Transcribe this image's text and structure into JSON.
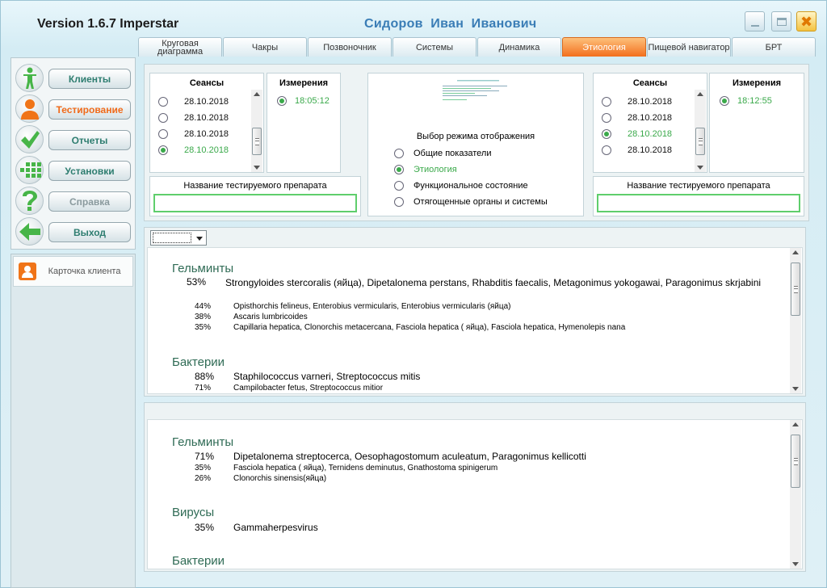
{
  "app": {
    "title": "Version 1.6.7 Imperstar",
    "patient": "Сидоров  Иван  Иванович"
  },
  "window_buttons": {
    "close_glyph": "✖"
  },
  "tabs": [
    "Круговая диаграмма",
    "Чакры",
    "Позвоночник",
    "Системы",
    "Динамика",
    "Этиология",
    "Пищевой навигатор",
    "БРТ"
  ],
  "active_tab": "Этиология",
  "nav": [
    {
      "label": "Клиенты",
      "icon": "person-icon",
      "state": "normal"
    },
    {
      "label": "Тестирование",
      "icon": "user-orange-icon",
      "state": "active"
    },
    {
      "label": "Отчеты",
      "icon": "check-icon",
      "state": "normal"
    },
    {
      "label": "Установки",
      "icon": "grid-icon",
      "state": "normal"
    },
    {
      "label": "Справка",
      "icon": "help-icon",
      "state": "disabled"
    },
    {
      "label": "Выход",
      "icon": "exit-arrow-icon",
      "state": "normal"
    }
  ],
  "card": {
    "label": "Карточка клиента",
    "icon": "client-card-icon"
  },
  "left_sessions": {
    "title": "Сеансы",
    "items": [
      {
        "date": "28.10.2018",
        "selected": false
      },
      {
        "date": "28.10.2018",
        "selected": false
      },
      {
        "date": "28.10.2018",
        "selected": false
      },
      {
        "date": "28.10.2018",
        "selected": true
      }
    ]
  },
  "left_measurements": {
    "title": "Измерения",
    "items": [
      {
        "time": "18:05:12",
        "selected": true
      }
    ]
  },
  "right_sessions": {
    "title": "Сеансы",
    "items": [
      {
        "date": "28.10.2018",
        "selected": false
      },
      {
        "date": "28.10.2018",
        "selected": false
      },
      {
        "date": "28.10.2018",
        "selected": true
      },
      {
        "date": "28.10.2018",
        "selected": false
      }
    ]
  },
  "right_measurements": {
    "title": "Измерения",
    "items": [
      {
        "time": "18:12:55",
        "selected": true
      }
    ]
  },
  "drug": {
    "label": "Название тестируемого препарата",
    "left_value": "",
    "right_value": ""
  },
  "display_mode": {
    "title": "Выбор режима отображения",
    "options": [
      {
        "label": "Общие показатели",
        "selected": false
      },
      {
        "label": "Этиология",
        "selected": true
      },
      {
        "label": "Функциональное состояние",
        "selected": false
      },
      {
        "label": "Отягощенные органы и системы",
        "selected": false
      }
    ]
  },
  "results1": {
    "categories": [
      {
        "name": "Гельминты",
        "entries": [
          {
            "pct": "53%",
            "text": "Strongyloides stercoralis (яйца), Dipetalonema perstans, Rhabditis faecalis, Metagonimus yokogawai, Paragonimus skrjabini",
            "size": "big"
          },
          {
            "pct": "44%",
            "text": "Opisthorchis felineus, Enterobius vermicularis, Enterobius vermicularis (яйца)",
            "size": "small"
          },
          {
            "pct": "38%",
            "text": "Ascaris lumbricoides",
            "size": "small"
          },
          {
            "pct": "35%",
            "text": "Capillaria hepatica, Clonorchis metacercana, Fasciola hepatica ( яйца), Fasciola hepatica, Hymenolepis nana",
            "size": "small"
          }
        ]
      },
      {
        "name": "Бактерии",
        "entries": [
          {
            "pct": "88%",
            "text": "Staphilococcus varneri, Streptococcus mitis",
            "size": "big"
          },
          {
            "pct": "71%",
            "text": "Campilobacter fetus, Streptococcus mitior",
            "size": "small"
          }
        ]
      }
    ]
  },
  "results2": {
    "categories": [
      {
        "name": "Гельминты",
        "entries": [
          {
            "pct": "71%",
            "text": "Dipetalonema streptocerca, Oesophagostomum aculeatum, Paragonimus kellicotti",
            "size": "big"
          },
          {
            "pct": "35%",
            "text": "Fasciola hepatica ( яйца), Ternidens deminutus, Gnathostoma spinigerum",
            "size": "small"
          },
          {
            "pct": "26%",
            "text": "Clonorchis sinensis(яйца)",
            "size": "small"
          }
        ]
      },
      {
        "name": "Вирусы",
        "entries": [
          {
            "pct": "35%",
            "text": "Gammaherpesvirus",
            "size": "big"
          }
        ]
      },
      {
        "name": "Бактерии",
        "entries": []
      }
    ]
  },
  "colors": {
    "accent": "#f36f1d",
    "selected": "#3aa94a",
    "nav_text": "#2e7d70",
    "title_blue": "#3a7db6"
  }
}
